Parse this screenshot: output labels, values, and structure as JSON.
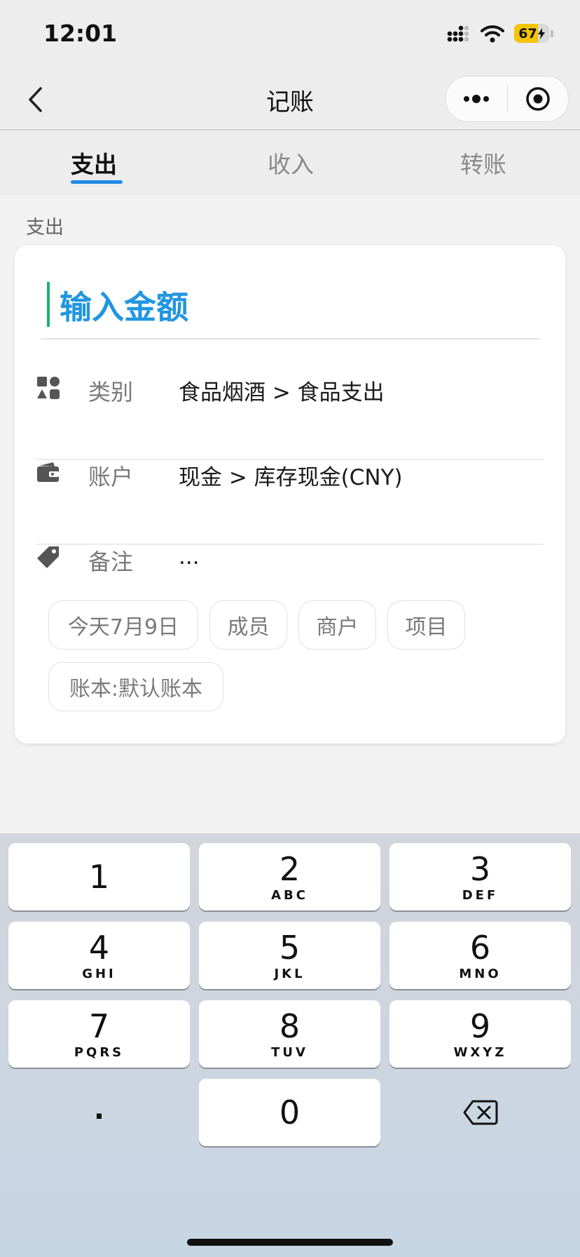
{
  "status": {
    "time": "12:01",
    "battery": "67",
    "battery_level": 0.67
  },
  "nav": {
    "title": "记账"
  },
  "tabs": [
    {
      "label": "支出",
      "active": true
    },
    {
      "label": "收入",
      "active": false
    },
    {
      "label": "转账",
      "active": false
    }
  ],
  "section_label": "支出",
  "form": {
    "amount_placeholder": "输入金额",
    "category": {
      "label": "类别",
      "value": "食品烟酒 > 食品支出",
      "icon": "category-icon"
    },
    "account": {
      "label": "账户",
      "value": "现金 > 库存现金(CNY)",
      "icon": "wallet-icon"
    },
    "note": {
      "label": "备注",
      "value": "...",
      "icon": "tag-icon"
    }
  },
  "chips": [
    "今天7月9日",
    "成员",
    "商户",
    "项目",
    "账本:默认账本"
  ],
  "keyboard": {
    "keys": [
      {
        "digit": "1",
        "letters": ""
      },
      {
        "digit": "2",
        "letters": "ABC"
      },
      {
        "digit": "3",
        "letters": "DEF"
      },
      {
        "digit": "4",
        "letters": "GHI"
      },
      {
        "digit": "5",
        "letters": "JKL"
      },
      {
        "digit": "6",
        "letters": "MNO"
      },
      {
        "digit": "7",
        "letters": "PQRS"
      },
      {
        "digit": "8",
        "letters": "TUV"
      },
      {
        "digit": "9",
        "letters": "WXYZ"
      },
      {
        "digit": "0",
        "letters": ""
      }
    ],
    "dot": "."
  },
  "colors": {
    "accent": "#2196e0",
    "tab_underline": "#1e8ae6",
    "caret": "#1ab36b",
    "battery": "#f5c400"
  }
}
